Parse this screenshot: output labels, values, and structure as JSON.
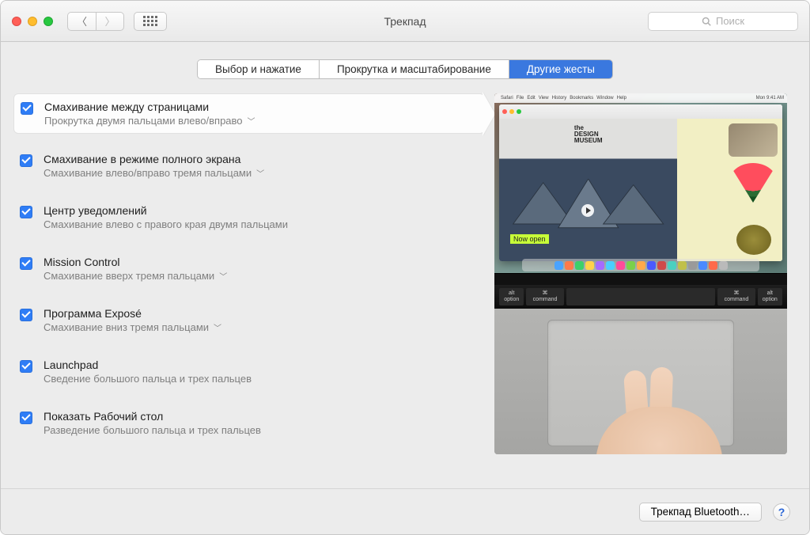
{
  "window": {
    "title": "Трекпад"
  },
  "search": {
    "placeholder": "Поиск"
  },
  "tabs": [
    {
      "label": "Выбор и нажатие",
      "selected": false
    },
    {
      "label": "Прокрутка и масштабирование",
      "selected": false
    },
    {
      "label": "Другие жесты",
      "selected": true
    }
  ],
  "options": [
    {
      "label": "Смахивание между страницами",
      "detail": "Прокрутка двумя пальцами влево/вправо",
      "dropdown": true,
      "selected": true,
      "checked": true
    },
    {
      "label": "Смахивание в режиме полного экрана",
      "detail": "Смахивание влево/вправо тремя пальцами",
      "dropdown": true,
      "selected": false,
      "checked": true
    },
    {
      "label": "Центр уведомлений",
      "detail": "Смахивание влево с правого края двумя пальцами",
      "dropdown": false,
      "selected": false,
      "checked": true
    },
    {
      "label": "Mission Control",
      "detail": "Смахивание вверх тремя пальцами",
      "dropdown": true,
      "selected": false,
      "checked": true
    },
    {
      "label": "Программа Exposé",
      "detail": "Смахивание вниз тремя пальцами",
      "dropdown": true,
      "selected": false,
      "checked": true
    },
    {
      "label": "Launchpad",
      "detail": "Сведение большого пальца и трех пальцев",
      "dropdown": false,
      "selected": false,
      "checked": true
    },
    {
      "label": "Показать Рабочий стол",
      "detail": "Разведение большого пальца и трех пальцев",
      "dropdown": false,
      "selected": false,
      "checked": true
    }
  ],
  "preview": {
    "menubar_left": [
      "Safari",
      "File",
      "Edit",
      "View",
      "History",
      "Bookmarks",
      "Window",
      "Help"
    ],
    "menubar_right": "Mon 9:41 AM",
    "design_museum": "the\nDESIGN\nMUSEUM",
    "now_open": "Now open",
    "keys": [
      "alt option",
      "⌘ command",
      "",
      "⌘ command",
      "alt option"
    ]
  },
  "footer": {
    "bluetooth": "Трекпад Bluetooth…",
    "help": "?"
  }
}
